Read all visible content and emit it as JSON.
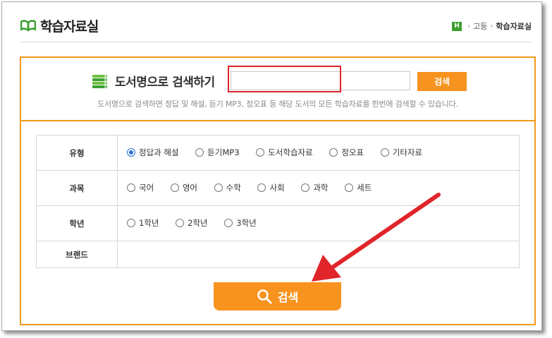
{
  "header": {
    "logo_text": "학습자료실",
    "breadcrumb": {
      "home": "H",
      "level1": "고등",
      "current": "학습자료실"
    }
  },
  "search": {
    "title": "도서명으로 검색하기",
    "input_value": "",
    "button_label": "검색",
    "description": "도서명으로 검색하면 정답 및 해설, 듣기 MP3, 정오표 등 해당 도서의 모든 학습자료를 한번에 검색할 수 있습니다."
  },
  "filters": {
    "type": {
      "label": "유형",
      "options": [
        "정답과 해설",
        "듣기MP3",
        "도서학습자료",
        "정오표",
        "기타자료"
      ],
      "selected": 0
    },
    "subject": {
      "label": "과목",
      "options": [
        "국어",
        "영어",
        "수학",
        "사회",
        "과학",
        "세트"
      ]
    },
    "grade": {
      "label": "학년",
      "options": [
        "1학년",
        "2학년",
        "3학년"
      ]
    },
    "brand": {
      "label": "브랜드"
    }
  },
  "main_search_button": {
    "label": "검색"
  },
  "colors": {
    "accent": "#f7931e",
    "highlight": "#e0252b",
    "brand_green": "#3aa02f"
  },
  "icons": {
    "logo": "open-book-icon",
    "search_title": "book-stack-icon",
    "button": "magnifier-icon",
    "home": "home-h-icon"
  }
}
